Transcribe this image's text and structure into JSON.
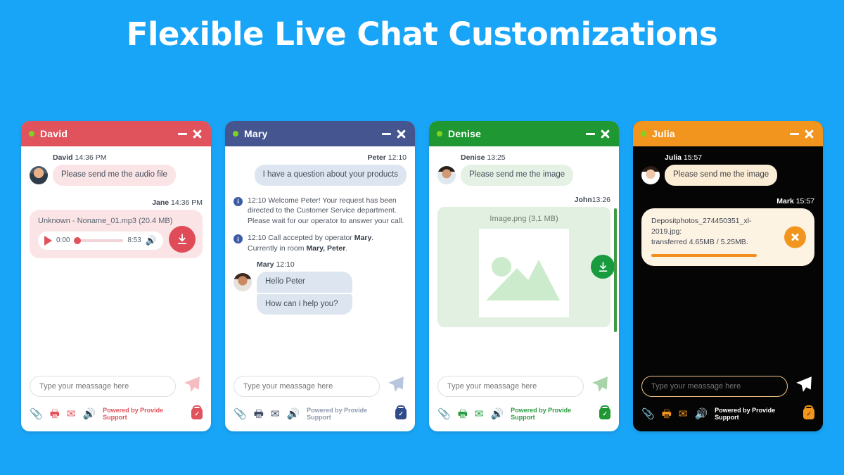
{
  "page": {
    "title": "Flexible Live Chat Customizations",
    "background_color": "#19a5f7"
  },
  "common": {
    "input_placeholder": "Type your meassage here",
    "powered_by": "Powered by Provide Support",
    "minimize_label": "−",
    "close_label": "×",
    "attach_icon": "paperclip-icon",
    "print_icon": "printer-icon",
    "email_icon": "envelope-icon",
    "sound_icon": "speaker-icon",
    "send_icon": "send-plane-icon",
    "lock_icon": "lock-check-icon",
    "status_dot_color": "#7ed321"
  },
  "panels": [
    {
      "id": "david",
      "title": "David",
      "accent": "#e0535c",
      "header_bg": "#e0535c",
      "body_bg": "#ffffff",
      "messages": [
        {
          "sender": "David",
          "time": "14:36 PM",
          "text": "Please send me the audio file"
        }
      ],
      "outgoing": {
        "sender": "Jane",
        "time": "14:36 PM",
        "file_name": "Unknown - Noname_01.mp3 (20.4 MB)",
        "current_time": "0:00",
        "total_time": "8:53",
        "download_label": "download-icon"
      }
    },
    {
      "id": "mary",
      "title": "Mary",
      "accent": "#4a5b9c",
      "header_bg": "#44558f",
      "body_bg": "#ffffff",
      "incoming": {
        "sender": "Peter",
        "time": "12:10",
        "text": "I have a question about your products"
      },
      "system": [
        "12:10 Welcome Peter! Your request has been directed to the Customer Service department. Please wait for our operator to answer your call.",
        "12:10 Call accepted by operator Mary. Currently in room Mary, Peter."
      ],
      "operator": {
        "sender": "Mary",
        "time": "12:10",
        "lines": [
          "Hello Peter",
          "How can i help you?"
        ]
      }
    },
    {
      "id": "denise",
      "title": "Denise",
      "accent": "#2a9d3f",
      "header_bg": "#1f9733",
      "body_bg": "#ffffff",
      "messages": [
        {
          "sender": "Denise",
          "time": "13:25",
          "text": "Please send me the image"
        }
      ],
      "outgoing": {
        "sender": "John",
        "time": "13:26",
        "file_name": "Image.png (3,1 MB)",
        "download_label": "download-icon"
      }
    },
    {
      "id": "julia",
      "title": "Julia",
      "accent": "#f2951f",
      "header_bg": "#f2951f",
      "body_bg": "#050505",
      "messages": [
        {
          "sender": "Julia",
          "time": "15:57",
          "text": "Please send me the image"
        }
      ],
      "transfer": {
        "sender": "Mark",
        "time": "15:57",
        "file_line_1": "Depositphotos_274450351_xl-2019.jpg:",
        "file_line_2": "transferred 4.65MB / 5.25MB.",
        "progress_percent": 88,
        "cancel_label": "cancel-icon"
      }
    }
  ]
}
